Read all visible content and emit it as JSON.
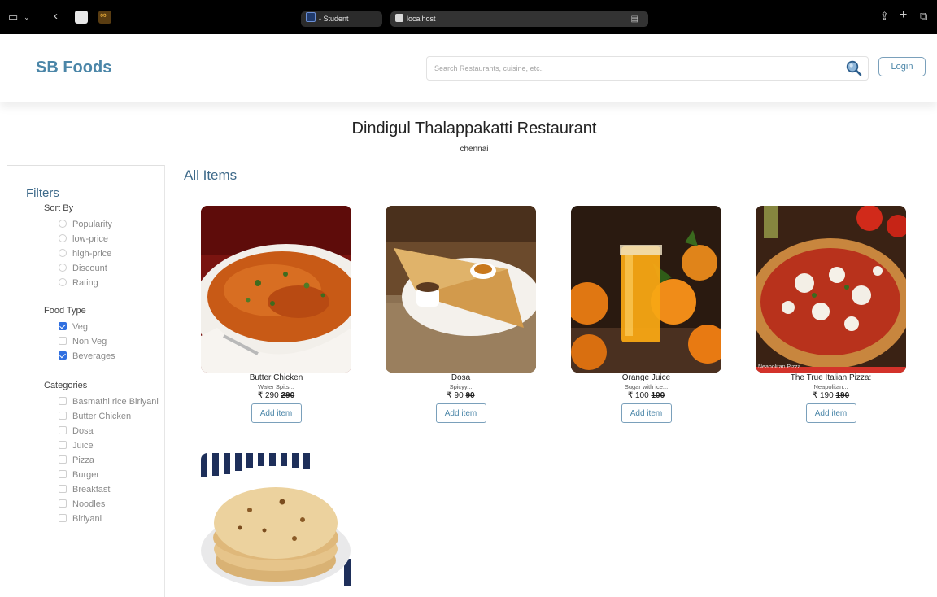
{
  "browser": {
    "tab_student": "- Student",
    "tab_url": "localhost"
  },
  "header": {
    "brand": "SB Foods",
    "search_placeholder": "Search Restaurants, cuisine, etc.,",
    "login_label": "Login"
  },
  "restaurant": {
    "name": "Dindigul Thalappakatti Restaurant",
    "location": "chennai"
  },
  "filters": {
    "title": "Filters",
    "sort_by": {
      "title": "Sort By",
      "options": [
        "Popularity",
        "low-price",
        "high-price",
        "Discount",
        "Rating"
      ]
    },
    "food_type": {
      "title": "Food Type",
      "options": [
        {
          "label": "Veg",
          "checked": true
        },
        {
          "label": "Non Veg",
          "checked": false
        },
        {
          "label": "Beverages",
          "checked": true
        }
      ]
    },
    "categories": {
      "title": "Categories",
      "options": [
        "Basmathi rice Biriyani",
        "Butter Chicken",
        "Dosa",
        "Juice",
        "Pizza",
        "Burger",
        "Breakfast",
        "Noodles",
        "Biriyani"
      ]
    }
  },
  "main": {
    "title": "All Items",
    "items": [
      {
        "name": "Butter Chicken",
        "desc": "Water Spits...",
        "price": "₹ 290",
        "old_price": "290",
        "button": "Add item"
      },
      {
        "name": "Dosa",
        "desc": "Spicyy...",
        "price": "₹ 90",
        "old_price": "90",
        "button": "Add item"
      },
      {
        "name": "Orange Juice",
        "desc": "Sugar with ice...",
        "price": "₹ 100",
        "old_price": "100",
        "button": "Add item"
      },
      {
        "name": "The True Italian Pizza:",
        "desc": "Neapolitan...",
        "price": "₹ 190",
        "old_price": "190",
        "button": "Add item",
        "image_caption": "Neapolitan Pizza"
      }
    ]
  },
  "colors": {
    "brand": "#4b86a8",
    "checkbox_checked": "#2f6fe0"
  }
}
